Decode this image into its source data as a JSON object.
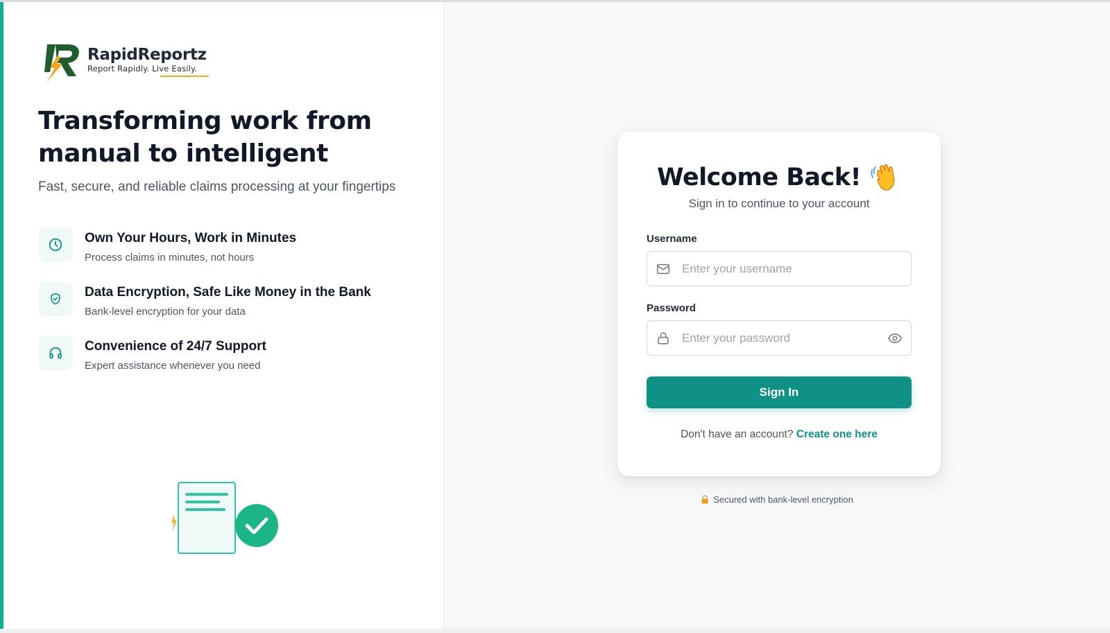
{
  "brand": {
    "name": "RapidReportz",
    "tagline": "Report Rapidly. Live Easily.",
    "accent_color": "#10b092",
    "logo_green": "#1f5c2e",
    "logo_bolt": "#f5a623"
  },
  "hero": {
    "title": "Transforming work from manual to intelligent",
    "subtitle": "Fast, secure, and reliable claims processing at your fingertips"
  },
  "features": [
    {
      "icon": "clock-icon",
      "title": "Own Your Hours, Work in Minutes",
      "description": "Process claims in minutes, not hours"
    },
    {
      "icon": "shield-check-icon",
      "title": "Data Encryption, Safe Like Money in the Bank",
      "description": "Bank-level encryption for your data"
    },
    {
      "icon": "headphones-icon",
      "title": "Convenience of 24/7 Support",
      "description": "Expert assistance whenever you need"
    }
  ],
  "login": {
    "title": "Welcome Back!",
    "title_icon": "waving-hand-icon",
    "subtitle": "Sign in to continue to your account",
    "username": {
      "label": "Username",
      "placeholder": "Enter your username",
      "value": "",
      "icon": "mail-icon"
    },
    "password": {
      "label": "Password",
      "placeholder": "Enter your password",
      "value": "",
      "icon": "lock-icon",
      "toggle_icon": "eye-icon"
    },
    "submit_label": "Sign In",
    "signup_prompt": "Don't have an account?",
    "signup_link": "Create one here",
    "primary_color": "#0f9185"
  },
  "footer": {
    "secured_text": "Secured with bank-level encryption",
    "icon": "lock-emoji-icon"
  }
}
